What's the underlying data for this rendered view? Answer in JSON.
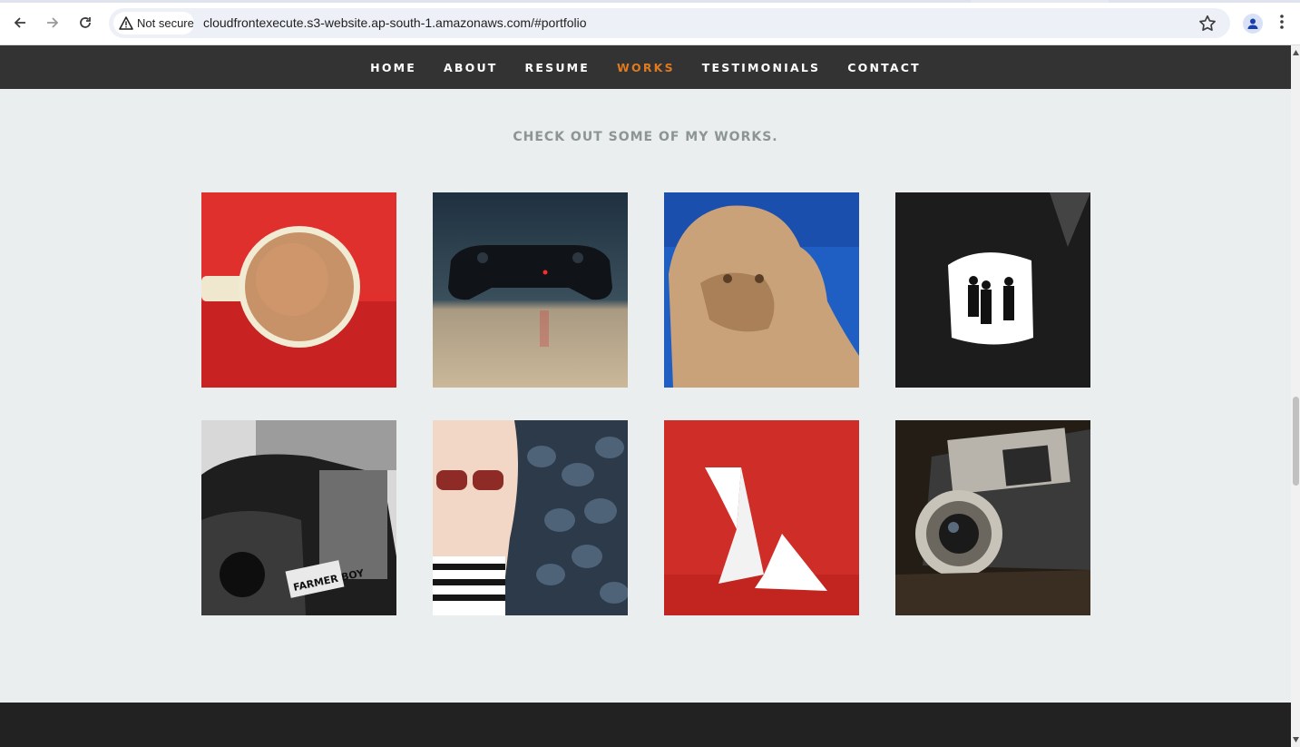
{
  "browser": {
    "security_label": "Not secure",
    "url": "cloudfrontexecute.s3-website.ap-south-1.amazonaws.com/#portfolio",
    "icons": [
      "back-arrow-icon",
      "forward-arrow-icon",
      "reload-icon",
      "warning-icon",
      "bookmark-star-icon",
      "profile-icon",
      "more-vert-icon"
    ]
  },
  "nav": {
    "items": [
      {
        "label": "HOME",
        "active": false
      },
      {
        "label": "ABOUT",
        "active": false
      },
      {
        "label": "RESUME",
        "active": false
      },
      {
        "label": "WORKS",
        "active": true
      },
      {
        "label": "TESTIMONIALS",
        "active": false
      },
      {
        "label": "CONTACT",
        "active": false
      }
    ],
    "active_color": "#e07a1f"
  },
  "portfolio": {
    "heading": "CHECK OUT SOME OF MY WORKS.",
    "items": [
      {
        "subject": "coffee-cup"
      },
      {
        "subject": "game-controller"
      },
      {
        "subject": "lion-statue"
      },
      {
        "subject": "cave-silhouettes"
      },
      {
        "subject": "vintage-car",
        "plate_text": "FARMER BOY"
      },
      {
        "subject": "woman-sunglasses"
      },
      {
        "subject": "origami-bird"
      },
      {
        "subject": "vintage-camera"
      }
    ]
  },
  "colors": {
    "page_bg": "#ebeeee",
    "nav_bg": "#333333",
    "footer_bg": "#222222"
  }
}
